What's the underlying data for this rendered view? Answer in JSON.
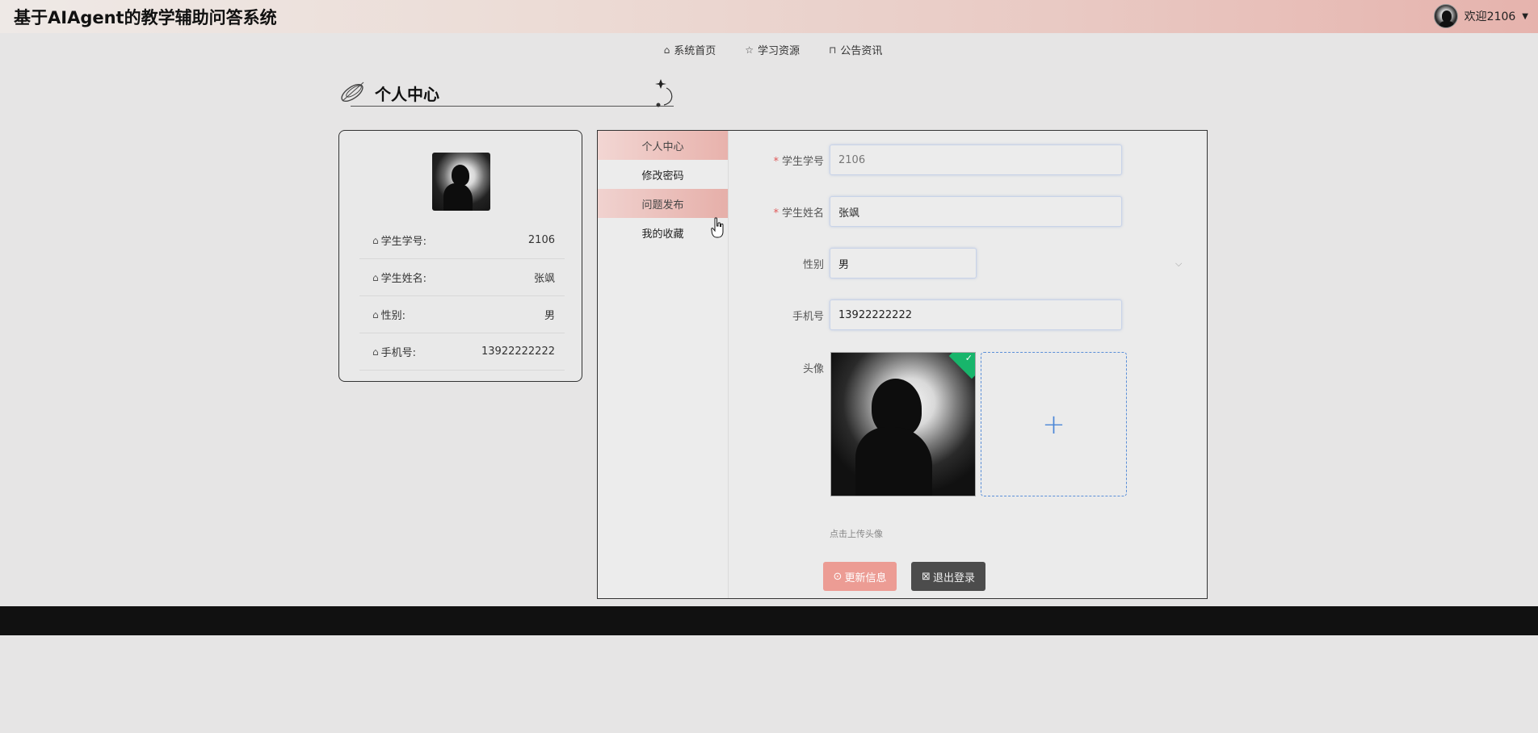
{
  "header": {
    "app_title": "基于AIAgent的教学辅助问答系统",
    "welcome": "欢迎2106",
    "caret": "▼"
  },
  "nav": {
    "items": [
      {
        "label": "系统首页",
        "icon": "home-icon"
      },
      {
        "label": "学习资源",
        "icon": "star-icon"
      },
      {
        "label": "公告资讯",
        "icon": "bag-icon"
      }
    ]
  },
  "section": {
    "title": "个人中心"
  },
  "profile_card": {
    "rows": [
      {
        "label": "学生学号:",
        "value": "2106"
      },
      {
        "label": "学生姓名:",
        "value": "张飒"
      },
      {
        "label": "性别:",
        "value": "男"
      },
      {
        "label": "手机号:",
        "value": "13922222222"
      }
    ]
  },
  "side_menu": {
    "items": [
      {
        "label": "个人中心",
        "state": "active"
      },
      {
        "label": "修改密码",
        "state": "normal"
      },
      {
        "label": "问题发布",
        "state": "hover"
      },
      {
        "label": "我的收藏",
        "state": "normal"
      }
    ]
  },
  "form": {
    "student_id_label": "学生学号",
    "student_id_value": "2106",
    "student_name_label": "学生姓名",
    "student_name_value": "张飒",
    "gender_label": "性别",
    "gender_value": "男",
    "phone_label": "手机号",
    "phone_value": "13922222222",
    "avatar_label": "头像",
    "upload_hint": "点击上传头像",
    "required_mark": "*"
  },
  "buttons": {
    "update_label": "更新信息",
    "logout_label": "退出登录"
  },
  "colors": {
    "accent": "#ec9c94",
    "header_gradient_end": "#e6b3ad",
    "success_badge": "#18b56b",
    "upload_border": "#5b8fd8"
  }
}
